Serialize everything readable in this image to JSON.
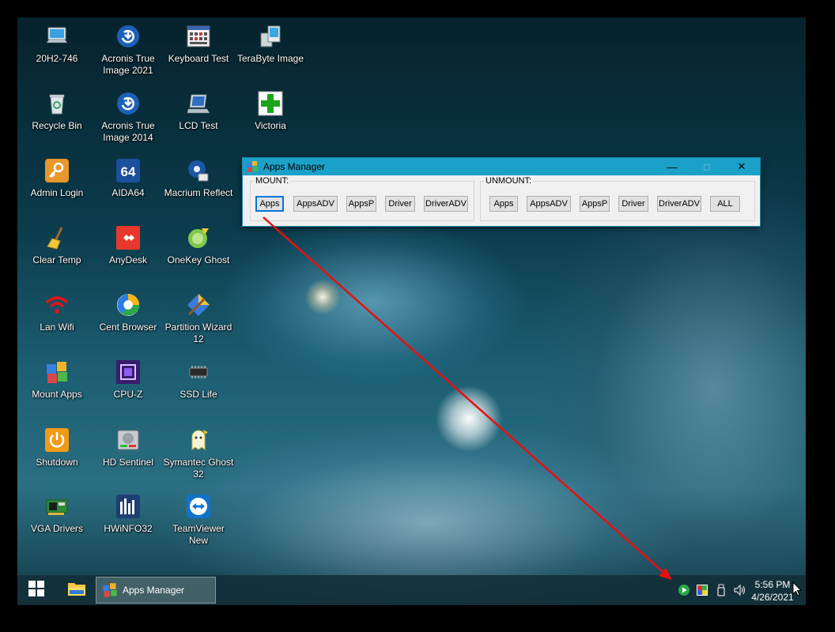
{
  "desktop": {
    "icons": [
      {
        "label": "20H2-746",
        "icon": "computer-icon"
      },
      {
        "label": "Recycle Bin",
        "icon": "recycle-bin-icon"
      },
      {
        "label": "Admin Login",
        "icon": "key-icon"
      },
      {
        "label": "Clear Temp",
        "icon": "broom-icon"
      },
      {
        "label": "Lan Wifi",
        "icon": "wifi-icon"
      },
      {
        "label": "Mount Apps",
        "icon": "apps-box-icon"
      },
      {
        "label": "Shutdown",
        "icon": "power-icon"
      },
      {
        "label": "VGA Drivers",
        "icon": "graphics-card-icon"
      },
      {
        "label": "Acronis True Image 2021",
        "icon": "acronis-icon"
      },
      {
        "label": "Acronis True Image 2014",
        "icon": "acronis-icon"
      },
      {
        "label": "AIDA64",
        "icon": "aida64-icon"
      },
      {
        "label": "AnyDesk",
        "icon": "anydesk-icon"
      },
      {
        "label": "Cent Browser",
        "icon": "browser-icon"
      },
      {
        "label": "CPU-Z",
        "icon": "cpu-icon"
      },
      {
        "label": "HD Sentinel",
        "icon": "hard-drive-icon"
      },
      {
        "label": "HWiNFO32",
        "icon": "hwinfo-icon"
      },
      {
        "label": "Keyboard Test",
        "icon": "keyboard-icon"
      },
      {
        "label": "LCD Test",
        "icon": "laptop-icon"
      },
      {
        "label": "Macrium Reflect",
        "icon": "macrium-icon"
      },
      {
        "label": "OneKey Ghost",
        "icon": "ghost-icon"
      },
      {
        "label": "Partition Wizard 12",
        "icon": "partition-wizard-icon"
      },
      {
        "label": "SSD Life",
        "icon": "ssd-chip-icon"
      },
      {
        "label": "Symantec Ghost 32",
        "icon": "ghost-icon"
      },
      {
        "label": "TeamViewer New",
        "icon": "teamviewer-icon"
      },
      {
        "label": "TeraByte Image",
        "icon": "terabyte-icon"
      },
      {
        "label": "Victoria",
        "icon": "green-cross-icon"
      }
    ]
  },
  "window": {
    "title": "Apps Manager",
    "minimize": "—",
    "maximize": "□",
    "close": "✕",
    "mount": {
      "label": "MOUNT:",
      "buttons": [
        "Apps",
        "AppsADV",
        "AppsP",
        "Driver",
        "DriverADV"
      ]
    },
    "unmount": {
      "label": "UNMOUNT:",
      "buttons": [
        "Apps",
        "AppsADV",
        "AppsP",
        "Driver",
        "DriverADV",
        "ALL"
      ]
    }
  },
  "taskbar": {
    "app_label": "Apps Manager",
    "time": "5:56 PM",
    "date": "4/26/2021",
    "tray_icons": [
      "play-circle-icon",
      "color-grid-icon",
      "usb-drive-icon",
      "volume-icon"
    ]
  },
  "annotation": {
    "arrow_color": "#e81010"
  },
  "colors": {
    "titlebar": "#1ba1c8",
    "focus_border": "#0078d7"
  }
}
